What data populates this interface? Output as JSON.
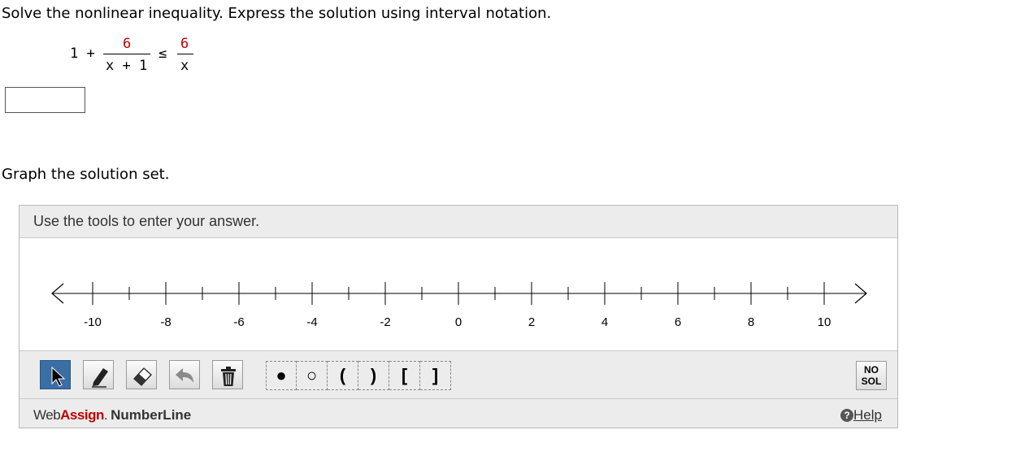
{
  "question": {
    "prompt": "Solve the nonlinear inequality. Express the solution using interval notation.",
    "inequality": {
      "lhs_term": "1 +",
      "lhs_numerator": "6",
      "lhs_denominator": "x + 1",
      "operator": "≤",
      "rhs_numerator": "6",
      "rhs_denominator": "x"
    },
    "answer_value": ""
  },
  "graph_section": {
    "label": "Graph the solution set."
  },
  "numberline_tool": {
    "instruction": "Use the tools to enter your answer.",
    "tick_labels": [
      "-10",
      "-8",
      "-6",
      "-4",
      "-2",
      "0",
      "2",
      "4",
      "6",
      "8",
      "10"
    ],
    "tools": [
      "pointer-icon",
      "pencil-icon",
      "eraser-icon",
      "undo-icon",
      "trash-icon"
    ],
    "endpoint_marks": [
      "●",
      "○",
      "(",
      ")",
      "[",
      "]"
    ],
    "no_solution_label_line1": "NO",
    "no_solution_label_line2": "SOL",
    "brand_web": "Web",
    "brand_assign": "Assign",
    "brand_dot": ".",
    "brand_product": "NumberLine",
    "help_icon": "?",
    "help_label": "Help",
    "accent_color": "#c00000",
    "active_tool_color": "#3a6ea5"
  }
}
